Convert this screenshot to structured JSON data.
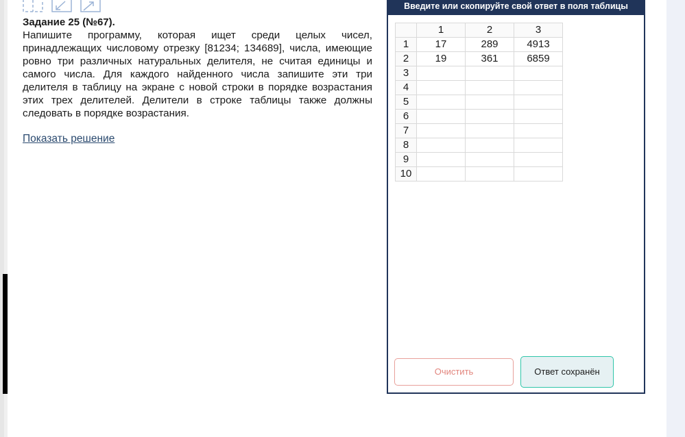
{
  "task": {
    "title": "Задание 25 (№67).",
    "text": "Напишите программу, которая ищет среди целых чисел, принадлежащих числовому отрезку [81234; 134689], числа, имеющие ровно три различных натуральных делителя, не считая единицы и самого числа. Для каждого найденного числа запишите эти три делителя в таблицу на экране с новой строки в порядке возрастания этих трех делителей. Делители в строке таблицы также должны следовать в порядке возрастания.",
    "show_solution": "Показать решение"
  },
  "answer_panel": {
    "header": "Введите или скопируйте свой ответ в поля таблицы",
    "columns": [
      "1",
      "2",
      "3"
    ],
    "rows": [
      {
        "num": "1",
        "cells": [
          "17",
          "289",
          "4913"
        ]
      },
      {
        "num": "2",
        "cells": [
          "19",
          "361",
          "6859"
        ]
      },
      {
        "num": "3",
        "cells": [
          "",
          "",
          ""
        ]
      },
      {
        "num": "4",
        "cells": [
          "",
          "",
          ""
        ]
      },
      {
        "num": "5",
        "cells": [
          "",
          "",
          ""
        ]
      },
      {
        "num": "6",
        "cells": [
          "",
          "",
          ""
        ]
      },
      {
        "num": "7",
        "cells": [
          "",
          "",
          ""
        ]
      },
      {
        "num": "8",
        "cells": [
          "",
          "",
          ""
        ]
      },
      {
        "num": "9",
        "cells": [
          "",
          "",
          ""
        ]
      },
      {
        "num": "10",
        "cells": [
          "",
          "",
          ""
        ]
      }
    ],
    "clear_button": "Очистить",
    "saved_button": "Ответ сохранён"
  },
  "icons": [
    "window-restore-icon",
    "expand-icon",
    "collapse-icon"
  ],
  "colors": {
    "header_bg": "#203459",
    "link": "#2b4a6f",
    "clear_border": "#e8a09a",
    "saved_border": "#2fc5a9"
  }
}
